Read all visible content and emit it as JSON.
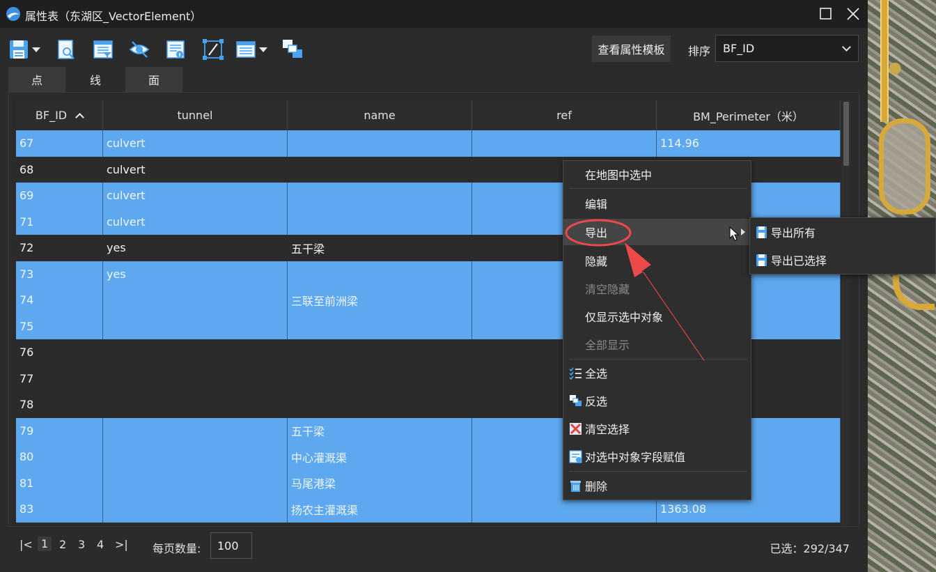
{
  "window": {
    "title": "属性表（东湖区_VectorElement）"
  },
  "toolbar": {
    "icons": [
      "save-icon",
      "preview-icon",
      "field-filter-icon",
      "hide-icon",
      "attribute-info-icon",
      "edit-field-icon",
      "display-options-icon",
      "relation-icon"
    ],
    "template_button": "查看属性模板",
    "sort_label": "排序",
    "sort_value": "BF_ID"
  },
  "tabs": [
    {
      "label": "点",
      "active": false
    },
    {
      "label": "线",
      "active": true
    },
    {
      "label": "面",
      "active": false
    }
  ],
  "table": {
    "columns": [
      "BF_ID",
      "tunnel",
      "name",
      "ref",
      "BM_Perimeter（米）"
    ],
    "sorted_column": "BF_ID",
    "sort_direction": "ascending",
    "rows": [
      {
        "id": "67",
        "tunnel": "culvert",
        "name": "",
        "ref": "",
        "perimeter": "114.96",
        "selected": true
      },
      {
        "id": "68",
        "tunnel": "culvert",
        "name": "",
        "ref": "",
        "perimeter": "",
        "selected": false
      },
      {
        "id": "69",
        "tunnel": "culvert",
        "name": "",
        "ref": "",
        "perimeter": "",
        "selected": true
      },
      {
        "id": "71",
        "tunnel": "culvert",
        "name": "",
        "ref": "",
        "perimeter": "",
        "selected": true
      },
      {
        "id": "72",
        "tunnel": "yes",
        "name": "五干梁",
        "ref": "",
        "perimeter": "",
        "selected": false
      },
      {
        "id": "73",
        "tunnel": "yes",
        "name": "",
        "ref": "",
        "perimeter": "",
        "selected": true
      },
      {
        "id": "74",
        "tunnel": "",
        "name": "三联至前洲梁",
        "ref": "",
        "perimeter": "",
        "selected": true
      },
      {
        "id": "75",
        "tunnel": "",
        "name": "",
        "ref": "",
        "perimeter": "",
        "selected": true
      },
      {
        "id": "76",
        "tunnel": "",
        "name": "",
        "ref": "",
        "perimeter": "",
        "selected": false
      },
      {
        "id": "77",
        "tunnel": "",
        "name": "",
        "ref": "",
        "perimeter": "",
        "selected": false
      },
      {
        "id": "78",
        "tunnel": "",
        "name": "",
        "ref": "",
        "perimeter": "",
        "selected": false
      },
      {
        "id": "79",
        "tunnel": "",
        "name": "五干梁",
        "ref": "",
        "perimeter": "",
        "selected": true
      },
      {
        "id": "80",
        "tunnel": "",
        "name": "中心灌溉渠",
        "ref": "",
        "perimeter": "",
        "selected": true
      },
      {
        "id": "81",
        "tunnel": "",
        "name": "马尾港梁",
        "ref": "",
        "perimeter": "",
        "selected": true
      },
      {
        "id": "83",
        "tunnel": "",
        "name": "扬农主灌溉渠",
        "ref": "",
        "perimeter": "1363.08",
        "selected": true
      }
    ]
  },
  "pager": {
    "first": "|<",
    "pages": [
      "1",
      "2",
      "3",
      "4"
    ],
    "current_page": "1",
    "last": ">|",
    "per_page_label": "每页数量:",
    "per_page_value": "100",
    "selected_count": "已选：292/347"
  },
  "context_menu": {
    "items": [
      {
        "label": "在地图中选中",
        "enabled": true
      },
      {
        "label": "编辑",
        "enabled": true
      },
      {
        "label": "导出",
        "enabled": true,
        "has_submenu": true,
        "highlighted": true
      },
      {
        "label": "隐藏",
        "enabled": true
      },
      {
        "label": "清空隐藏",
        "enabled": false
      },
      {
        "label": "仅显示选中对象",
        "enabled": true
      },
      {
        "label": "全部显示",
        "enabled": false
      },
      {
        "label": "全选",
        "enabled": true,
        "icon": "select-all-icon"
      },
      {
        "label": "反选",
        "enabled": true,
        "icon": "invert-selection-icon"
      },
      {
        "label": "清空选择",
        "enabled": true,
        "icon": "clear-selection-icon"
      },
      {
        "label": "对选中对象字段赋值",
        "enabled": true,
        "icon": "assign-field-icon"
      },
      {
        "label": "删除",
        "enabled": true,
        "icon": "trash-icon"
      }
    ]
  },
  "submenu": {
    "items": [
      {
        "label": "导出所有",
        "icon": "export-file-icon"
      },
      {
        "label": "导出已选择",
        "icon": "export-file-icon"
      }
    ]
  },
  "colors": {
    "selected_row": "#5ea8f0",
    "background": "#2b2b2b",
    "annotation": "#ec4a4a"
  }
}
